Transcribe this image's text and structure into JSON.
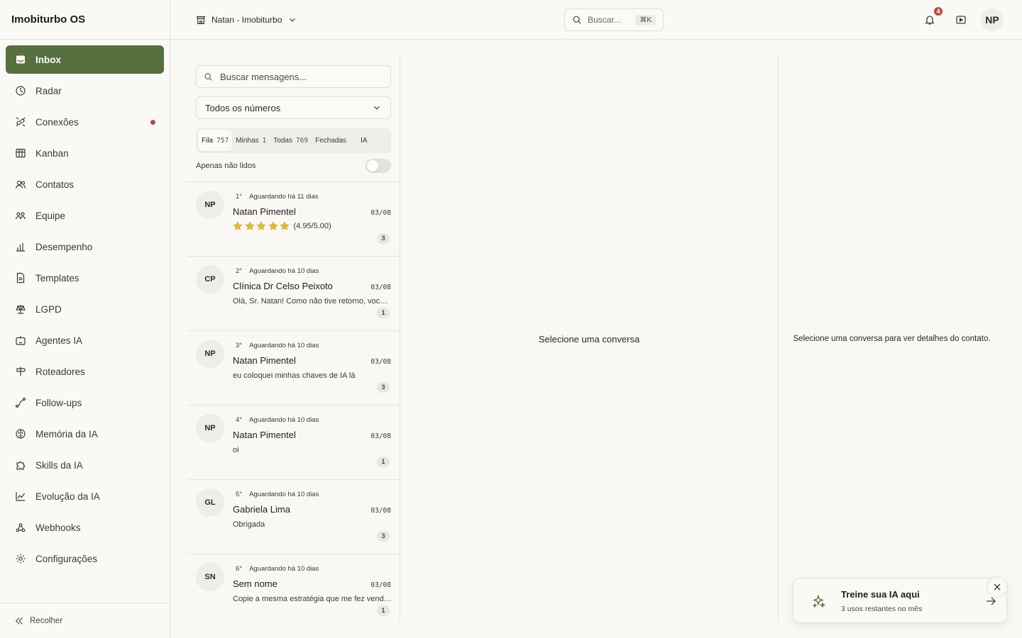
{
  "app": {
    "name": "Imobiturbo OS"
  },
  "sidebar": {
    "items": [
      {
        "label": "Inbox",
        "icon": "inbox-icon",
        "active": true
      },
      {
        "label": "Radar",
        "icon": "radar-icon"
      },
      {
        "label": "Conexões",
        "icon": "plug-icon",
        "dot": true
      },
      {
        "label": "Kanban",
        "icon": "kanban-icon"
      },
      {
        "label": "Contatos",
        "icon": "contacts-icon"
      },
      {
        "label": "Equipe",
        "icon": "team-icon"
      },
      {
        "label": "Desempenho",
        "icon": "bar-chart-icon"
      },
      {
        "label": "Templates",
        "icon": "file-text-icon"
      },
      {
        "label": "LGPD",
        "icon": "scale-icon"
      },
      {
        "label": "Agentes IA",
        "icon": "bot-icon"
      },
      {
        "label": "Roteadores",
        "icon": "signpost-icon"
      },
      {
        "label": "Follow-ups",
        "icon": "route-icon"
      },
      {
        "label": "Memória da IA",
        "icon": "brain-icon"
      },
      {
        "label": "Skills da IA",
        "icon": "puzzle-icon"
      },
      {
        "label": "Evolução da IA",
        "icon": "trend-icon"
      },
      {
        "label": "Webhooks",
        "icon": "webhook-icon"
      },
      {
        "label": "Configurações",
        "icon": "gear-icon"
      }
    ],
    "collapse_label": "Recolher"
  },
  "topbar": {
    "workspace_label": "Natan - Imobiturbo",
    "search_label": "Buscar...",
    "search_shortcut": "⌘K",
    "notification_count": "4",
    "user_initials": "NP"
  },
  "inbox": {
    "search_placeholder": "Buscar mensagens...",
    "number_filter": "Todos os números",
    "tabs": [
      {
        "label": "Fila",
        "count": "757",
        "active": true
      },
      {
        "label": "Minhas",
        "count": "1"
      },
      {
        "label": "Todas",
        "count": "769"
      },
      {
        "label": "Fechadas",
        "count": ""
      },
      {
        "label": "IA",
        "count": ""
      }
    ],
    "unread_label": "Apenas não lidos",
    "conversations": [
      {
        "initials": "NP",
        "position": "1°",
        "waiting": "Aguardando há 11 dias",
        "name": "Natan Pimentel",
        "date": "03/08",
        "preview": "",
        "rating": "(4.95/5.00)",
        "stars": 5,
        "unread": "3"
      },
      {
        "initials": "CP",
        "position": "2°",
        "waiting": "Aguardando há 10 dias",
        "name": "Clínica Dr Celso Peixoto",
        "date": "03/08",
        "preview": "Olá, Sr. Natan! Como não tive retorno, você ainda tem interesse?",
        "unread": "1"
      },
      {
        "initials": "NP",
        "position": "3°",
        "waiting": "Aguardando há 10 dias",
        "name": "Natan Pimentel",
        "date": "03/08",
        "preview": "eu coloquei minhas chaves de IA lá",
        "unread": "3"
      },
      {
        "initials": "NP",
        "position": "4°",
        "waiting": "Aguardando há 10 dias",
        "name": "Natan Pimentel",
        "date": "03/08",
        "preview": "oi",
        "unread": "1"
      },
      {
        "initials": "GL",
        "position": "5°",
        "waiting": "Aguardando há 10 dias",
        "name": "Gabriela Lima",
        "date": "03/08",
        "preview": "Obrigada",
        "unread": "3"
      },
      {
        "initials": "SN",
        "position": "6°",
        "waiting": "Aguardando há 10 dias",
        "name": "Sem nome",
        "date": "03/08",
        "preview": "Copie a mesma estratégia que me fez vender mais",
        "unread": "1"
      }
    ]
  },
  "chat": {
    "empty_label": "Selecione uma conversa"
  },
  "details": {
    "empty_label": "Selecione uma conversa para ver detalhes do contato."
  },
  "toast": {
    "title": "Treine sua IA aqui",
    "subtitle": "3 usos restantes no mês"
  },
  "colors": {
    "accent": "#56703f",
    "danger": "#b74b3a",
    "star": "#e8b923",
    "background": "#f9f8f4"
  }
}
